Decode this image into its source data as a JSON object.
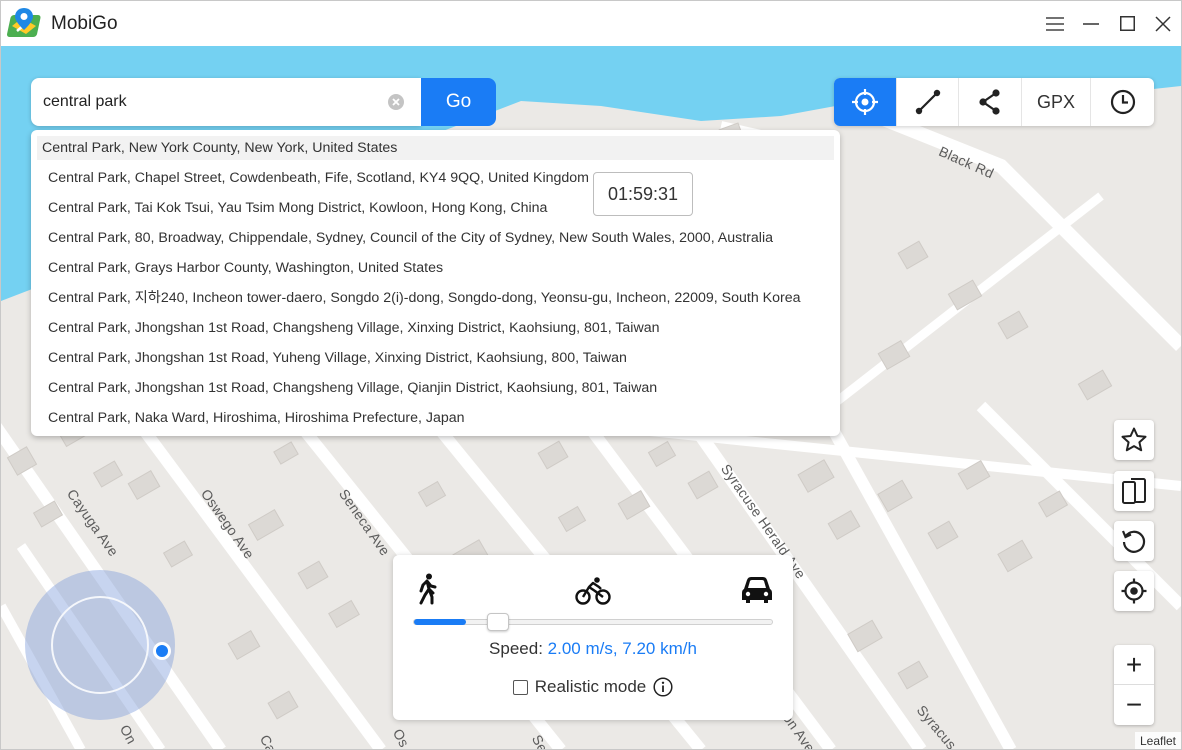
{
  "app": {
    "title": "MobiGo"
  },
  "search": {
    "value": "central park",
    "go_label": "Go"
  },
  "suggestions": [
    "Central Park, New York County, New York, United States",
    "Central Park, Chapel Street, Cowdenbeath, Fife, Scotland, KY4 9QQ, United Kingdom",
    "Central Park, Tai Kok Tsui, Yau Tsim Mong District, Kowloon, Hong Kong, China",
    "Central Park, 80, Broadway, Chippendale, Sydney, Council of the City of Sydney, New South Wales, 2000, Australia",
    "Central Park, Grays Harbor County, Washington, United States",
    "Central Park, 지하240, Incheon tower-daero, Songdo 2(i)-dong, Songdo-dong, Yeonsu-gu, Incheon, 22009, South Korea",
    "Central Park, Jhongshan 1st Road, Changsheng Village, Xinxing District, Kaohsiung, 801, Taiwan",
    "Central Park, Jhongshan 1st Road, Yuheng Village, Xinxing District, Kaohsiung, 800, Taiwan",
    "Central Park, Jhongshan 1st Road, Changsheng Village, Qianjin District, Kaohsiung, 801, Taiwan",
    "Central Park, Naka Ward, Hiroshima, Hiroshima Prefecture, Japan"
  ],
  "timer": "01:59:31",
  "toolbar": {
    "modes": [
      {
        "name": "teleport-mode",
        "icon": "crosshair-icon",
        "active": true
      },
      {
        "name": "two-spot-mode",
        "icon": "two-spot-route-icon",
        "active": false
      },
      {
        "name": "multi-spot-mode",
        "icon": "share-nodes-icon",
        "active": false
      },
      {
        "name": "gpx-import",
        "label": "GPX",
        "active": false
      },
      {
        "name": "history",
        "icon": "clock-icon",
        "active": false
      }
    ]
  },
  "side_buttons": [
    "star-icon",
    "device-switch-icon",
    "reset-icon",
    "locate-icon"
  ],
  "zoom": {
    "in_label": "+",
    "out_label": "−"
  },
  "speed_panel": {
    "speed_label": "Speed:",
    "speed_value": "2.00 m/s, 7.20 km/h",
    "slider_fraction": 0.14,
    "realistic_label": "Realistic mode",
    "realistic_checked": false
  },
  "map": {
    "roads": {
      "black_rd": "Black Rd",
      "cayuga": "Cayuga Ave",
      "oswego": "Oswego Ave",
      "seneca": "Seneca Ave",
      "syracuse_herald": "Syracuse Herald Ave",
      "partial_on": "On",
      "partial_c": "Ca",
      "partial_os": "Os",
      "partial_se": "Se",
      "partial_on_ave": "on Ave",
      "partial_syracuse": "Syracus"
    },
    "attribution": "Leaflet"
  },
  "colors": {
    "accent": "#1a7cf5",
    "water": "#74d1f2",
    "land": "#ebe9e6",
    "road": "#ffffff"
  }
}
